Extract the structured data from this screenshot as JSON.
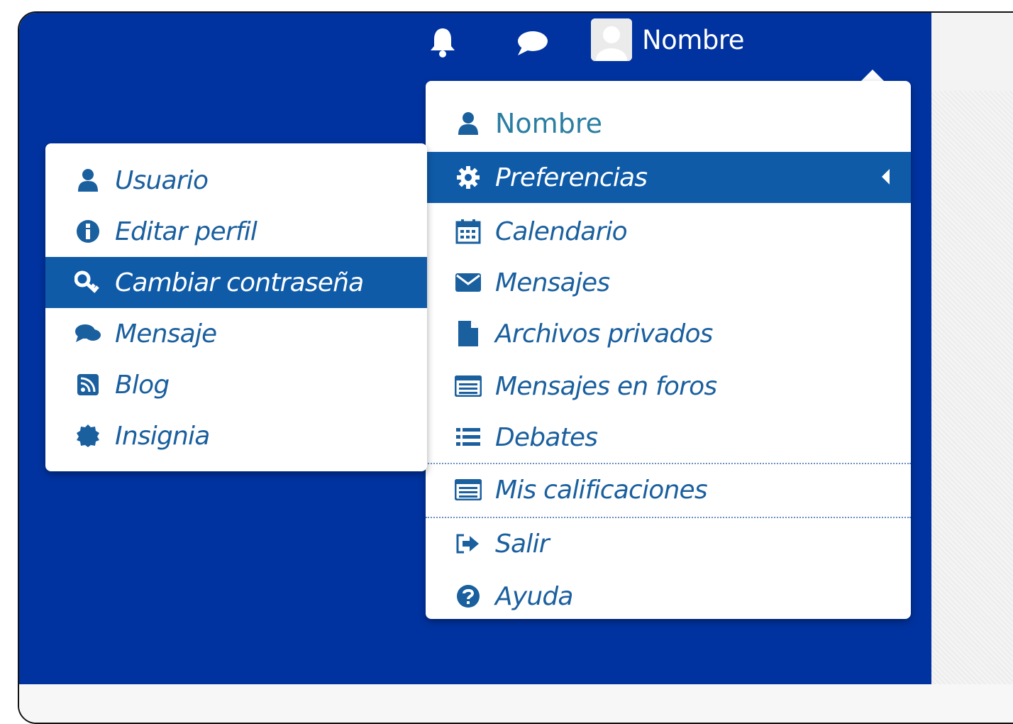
{
  "header": {
    "notifications_icon": "bell-icon",
    "messages_icon": "chat-icon",
    "user_name": "Nombre"
  },
  "user_menu": {
    "header_label": "Nombre",
    "items": [
      {
        "label": "Preferencias",
        "icon": "gear-icon",
        "active": true
      },
      {
        "label": "Calendario",
        "icon": "calendar-icon"
      },
      {
        "label": "Mensajes",
        "icon": "envelope-icon"
      },
      {
        "label": "Archivos privados",
        "icon": "file-icon"
      },
      {
        "label": "Mensajes en foros",
        "icon": "list-alt-icon"
      },
      {
        "label": "Debates",
        "icon": "list-icon"
      },
      {
        "label": "Mis calificaciones",
        "icon": "list-alt-icon"
      },
      {
        "label": "Salir",
        "icon": "sign-out-icon"
      },
      {
        "label": "Ayuda",
        "icon": "question-icon"
      }
    ]
  },
  "preferences_submenu": {
    "items": [
      {
        "label": "Usuario",
        "icon": "user-icon"
      },
      {
        "label": "Editar perfil",
        "icon": "info-icon"
      },
      {
        "label": "Cambiar contraseña",
        "icon": "key-icon",
        "active": true
      },
      {
        "label": "Mensaje",
        "icon": "comments-icon"
      },
      {
        "label": "Blog",
        "icon": "rss-icon"
      },
      {
        "label": "Insignia",
        "icon": "badge-icon"
      }
    ]
  },
  "colors": {
    "navbar": "#0033a0",
    "active_item": "#0f5ba8",
    "link": "#1a5f9e",
    "header_link": "#2a7ea2"
  }
}
